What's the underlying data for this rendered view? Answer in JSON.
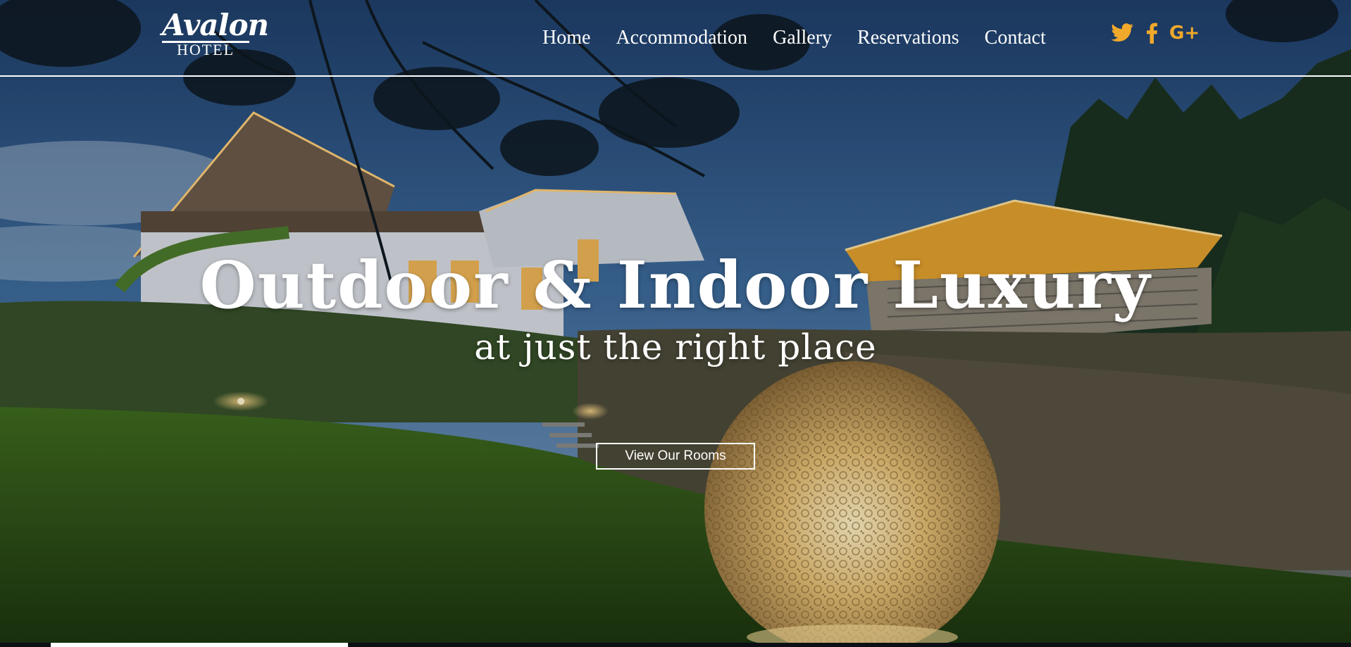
{
  "brand": {
    "script": "Avalon",
    "sub": "HOTEL"
  },
  "nav": {
    "items": [
      {
        "label": "Home"
      },
      {
        "label": "Accommodation"
      },
      {
        "label": "Gallery"
      },
      {
        "label": "Reservations"
      },
      {
        "label": "Contact"
      }
    ]
  },
  "social": {
    "color": "#f0a92b",
    "icons": [
      "twitter-icon",
      "facebook-icon",
      "google-plus-icon"
    ],
    "google_plus_text": "G+"
  },
  "hero": {
    "headline": "Outdoor & Indoor Luxury",
    "subheadline": "at just the right place",
    "cta_label": "View Our Rooms",
    "slider_progress": 0.22
  }
}
